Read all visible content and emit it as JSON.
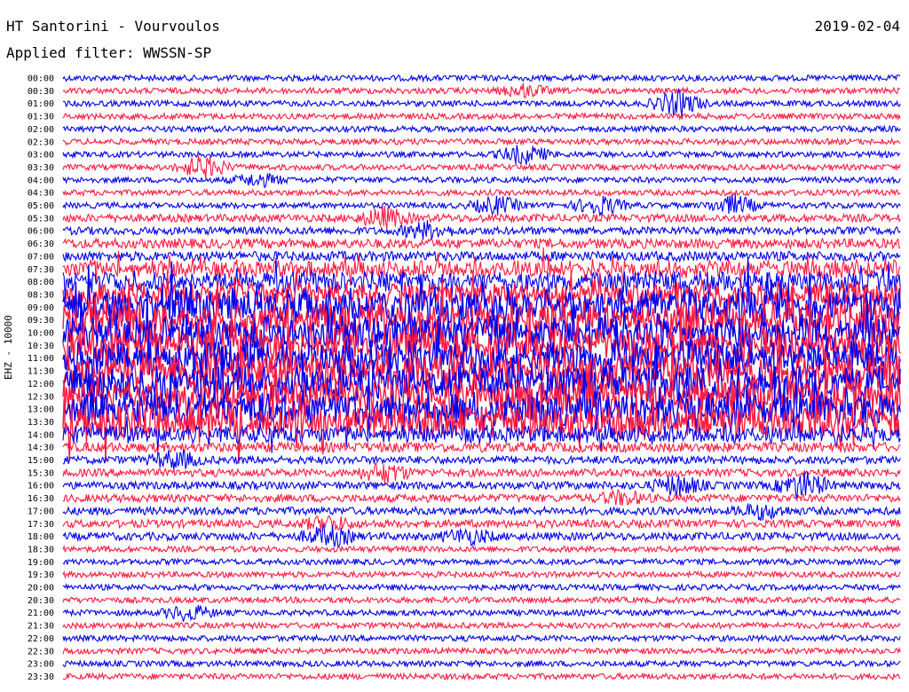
{
  "header": {
    "station": "HT Santorini - Vourvoulos",
    "date": "2019-02-04",
    "filter": "Applied filter: WWSSN-SP"
  },
  "channel_label": "EHZ - 10000",
  "colors": {
    "trace_a": "#0000ee",
    "trace_b": "#ff1a40",
    "background": "#ffffff",
    "text": "#000000"
  },
  "chart_data": {
    "type": "helicorder",
    "title": "HT Santorini - Vourvoulos",
    "subtitle": "Applied filter: WWSSN-SP",
    "date": "2019-02-04",
    "ylabel": "EHZ - 10000",
    "line_interval_minutes": 30,
    "series_colors": [
      "#0000ee",
      "#ff1a40"
    ],
    "time_labels": [
      "00:00",
      "00:30",
      "01:00",
      "01:30",
      "02:00",
      "02:30",
      "03:00",
      "03:30",
      "04:00",
      "04:30",
      "05:00",
      "05:30",
      "06:00",
      "06:30",
      "07:00",
      "07:30",
      "08:00",
      "08:30",
      "09:00",
      "09:30",
      "10:00",
      "10:30",
      "11:00",
      "11:30",
      "12:00",
      "12:30",
      "13:00",
      "13:30",
      "14:00",
      "14:30",
      "15:00",
      "15:30",
      "16:00",
      "16:30",
      "17:00",
      "17:30",
      "18:00",
      "18:30",
      "19:00",
      "19:30",
      "20:00",
      "20:30",
      "21:00",
      "21:30",
      "22:00",
      "22:30",
      "23:00",
      "23:30"
    ],
    "activity_level": [
      1,
      1,
      1,
      1,
      1,
      1,
      1,
      1,
      1,
      1,
      1,
      2,
      2,
      3,
      3,
      4,
      5,
      6,
      9,
      9,
      9,
      9,
      9,
      9,
      9,
      9,
      9,
      9,
      4,
      3,
      2,
      2,
      2,
      2,
      2,
      2,
      2,
      1,
      1,
      1,
      1,
      1,
      1,
      1,
      1,
      1,
      1,
      1
    ],
    "events": [
      {
        "line": "00:30",
        "minute": 16.5,
        "amplitude": 1.4
      },
      {
        "line": "01:00",
        "minute": 22.0,
        "amplitude": 3.0
      },
      {
        "line": "03:00",
        "minute": 16.5,
        "amplitude": 2.2
      },
      {
        "line": "03:30",
        "minute": 5.0,
        "amplitude": 2.6
      },
      {
        "line": "04:00",
        "minute": 7.0,
        "amplitude": 1.4
      },
      {
        "line": "05:00",
        "minute": 15.5,
        "amplitude": 2.0
      },
      {
        "line": "05:00",
        "minute": 19.2,
        "amplitude": 2.2
      },
      {
        "line": "05:00",
        "minute": 24.0,
        "amplitude": 2.2
      },
      {
        "line": "05:30",
        "minute": 11.5,
        "amplitude": 2.2
      },
      {
        "line": "06:00",
        "minute": 13.0,
        "amplitude": 1.8
      },
      {
        "line": "15:00",
        "minute": 4.0,
        "amplitude": 2.0
      },
      {
        "line": "15:30",
        "minute": 11.5,
        "amplitude": 2.2
      },
      {
        "line": "16:00",
        "minute": 22.0,
        "amplitude": 2.2
      },
      {
        "line": "16:00",
        "minute": 26.5,
        "amplitude": 3.0
      },
      {
        "line": "16:30",
        "minute": 20.0,
        "amplitude": 1.4
      },
      {
        "line": "17:00",
        "minute": 25.0,
        "amplitude": 1.6
      },
      {
        "line": "17:30",
        "minute": 9.5,
        "amplitude": 1.6
      },
      {
        "line": "18:00",
        "minute": 9.5,
        "amplitude": 2.2
      },
      {
        "line": "18:00",
        "minute": 14.5,
        "amplitude": 1.6
      },
      {
        "line": "21:00",
        "minute": 4.5,
        "amplitude": 1.8
      }
    ]
  }
}
